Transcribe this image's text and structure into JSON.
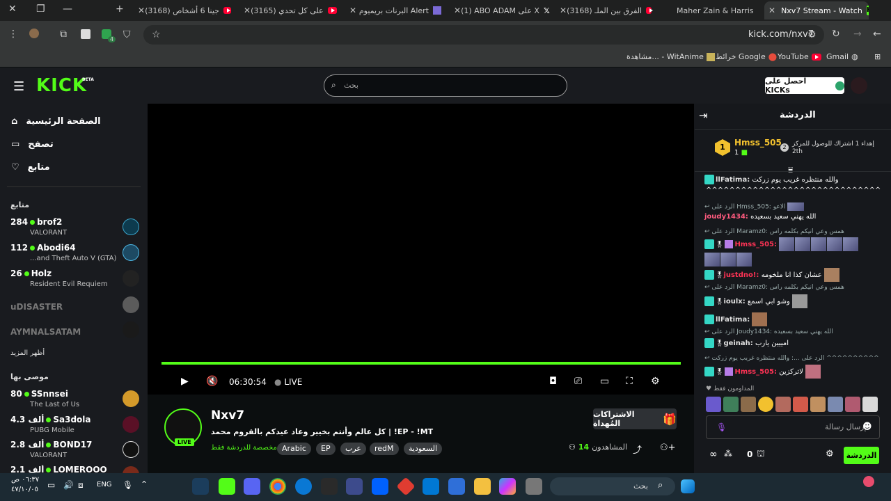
{
  "browser": {
    "tabs": [
      {
        "title": "(3168) جينا 6 أشخاص",
        "icon": "youtube-icon"
      },
      {
        "title": "(3165) على كل تحدي",
        "icon": "youtube-icon"
      },
      {
        "title": "البرنات بريميوم Alert",
        "icon": "app-icon"
      },
      {
        "title": "(1) ABO ADAM على X",
        "icon": "x-icon"
      },
      {
        "title": "(3168) الفرق بين الملـ",
        "icon": "youtube-icon"
      },
      {
        "title": "Maher Zain & Harris",
        "icon": "youtube-icon"
      },
      {
        "title": "Nxv7 Stream - Watch",
        "icon": "kick-icon"
      }
    ],
    "url": "kick.com/nxv7",
    "bookmarks": [
      "Gmail",
      "YouTube",
      "خرائط Google",
      "مشاهدة... - WitAnime"
    ],
    "extension_badge": "4"
  },
  "header": {
    "logo": "KICK",
    "logo_sup": "BETA",
    "search_placeholder": "بحث",
    "kicks_button": "احصل على KICKs"
  },
  "sidebar": {
    "nav": [
      {
        "label": "الصفحة الرئيسية"
      },
      {
        "label": "تصفح"
      },
      {
        "label": "متابع"
      }
    ],
    "following_title": "متابع",
    "following": [
      {
        "count": "284",
        "name": "brof2",
        "category": "VALORANT"
      },
      {
        "count": "112",
        "name": "Abodi64",
        "category": "...and Theft Auto V (GTA)"
      },
      {
        "count": "26",
        "name": "Holz",
        "category": "Resident Evil Requiem"
      }
    ],
    "offline": [
      "uDISASTER",
      "AYMNALSATAM"
    ],
    "show_more": "أظهر المزيد",
    "recommended_title": "موصى بها",
    "recommended": [
      {
        "count": "80",
        "name": "SSnnsei",
        "category": "The Last of Us"
      },
      {
        "count": "4.3 ألف",
        "name": "Sa3dola",
        "category": "PUBG Mobile"
      },
      {
        "count": "2.8 ألف",
        "name": "BOND17",
        "category": "VALORANT"
      },
      {
        "count": "2.1 ألف",
        "name": "LOMEROOO",
        "category": ""
      }
    ]
  },
  "player": {
    "time": "06:30:54",
    "live": "LIVE",
    "progress_fraction": 1.0
  },
  "stream": {
    "channel": "Nxv7",
    "live_badge": "LIVE",
    "title": "كل عالم وأنتم بخيير وعاد عيدكم بالقروم محمد | !EP - !MT",
    "chat_note": "مخصصة للدردشة فقط",
    "tags": [
      "السعودية",
      "redM",
      "عرب",
      "EP",
      "Arabic"
    ],
    "viewers_label": "المشاهدون",
    "viewers": "14",
    "gift_button": "الاشتراكات المُهداة"
  },
  "chat": {
    "title": "الدردشة",
    "leader_name": "Hmss_505",
    "leader_count": "1",
    "leader_text": "إهداء 1 اشتراك للوصول للمركز",
    "leader_rank": "2th",
    "messages": [
      {
        "type": "msg",
        "user": "llFatima:",
        "text": "والله منتظره غريب يوم زركت",
        "color": "#e0e0e0"
      },
      {
        "type": "text",
        "text": "^^^^^^^^^^^^^^^^^^^^^^^^^^^^^^"
      },
      {
        "type": "reply",
        "text": "الرد على Hmss_505: الاعو"
      },
      {
        "type": "msg",
        "user": "joudy1434:",
        "text": "الله يهني سعيد بسعيده",
        "color": "#ff5b7f"
      },
      {
        "type": "reply",
        "text": "الرد على Maramz0: همس وعي انيكم بكلمه راس"
      },
      {
        "type": "msg",
        "user": "Hmss_505:",
        "text": "",
        "color": "#ff3355"
      },
      {
        "type": "msg",
        "user": "justdno!:",
        "text": "عشان كذا انا ملخومه",
        "color": "#ff3355"
      },
      {
        "type": "reply",
        "text": "الرد على Maramz0: همس وعي انيكم بكلمه راس"
      },
      {
        "type": "msg",
        "user": "ioulx:",
        "text": "وشو ابي اسمع",
        "color": "#e0e0e0"
      },
      {
        "type": "msg",
        "user": "llFatima:",
        "text": "",
        "color": "#e0e0e0"
      },
      {
        "type": "reply",
        "text": "الرد على Joudy1434: الله يهني سعيد بسعيده"
      },
      {
        "type": "msg",
        "user": "geinah:",
        "text": "امييين يارب",
        "color": "#e0e0e0"
      },
      {
        "type": "reply",
        "text": "الرد على ...: والله منتظره غريب يوم زركت ^^^^^^^^^^^^^^^^"
      },
      {
        "type": "msg",
        "user": "Hmss_505:",
        "text": "لاتركزين",
        "color": "#ff3355"
      }
    ],
    "donors_label": "المداومون فقط",
    "input_placeholder": "إرسال رسالة",
    "points": "0",
    "send_button": "الدردشة"
  },
  "taskbar": {
    "time": "٠٦:٣٧ ص",
    "date": "٤٧/١٠/٠٥",
    "lang": "ENG",
    "search_placeholder": "بحث"
  },
  "colors": {
    "kick_green": "#53fc18",
    "bg_dark": "#0b0e0f",
    "panel": "#191b1f",
    "chat_bg": "#16181c",
    "gold": "#f2c12e"
  }
}
